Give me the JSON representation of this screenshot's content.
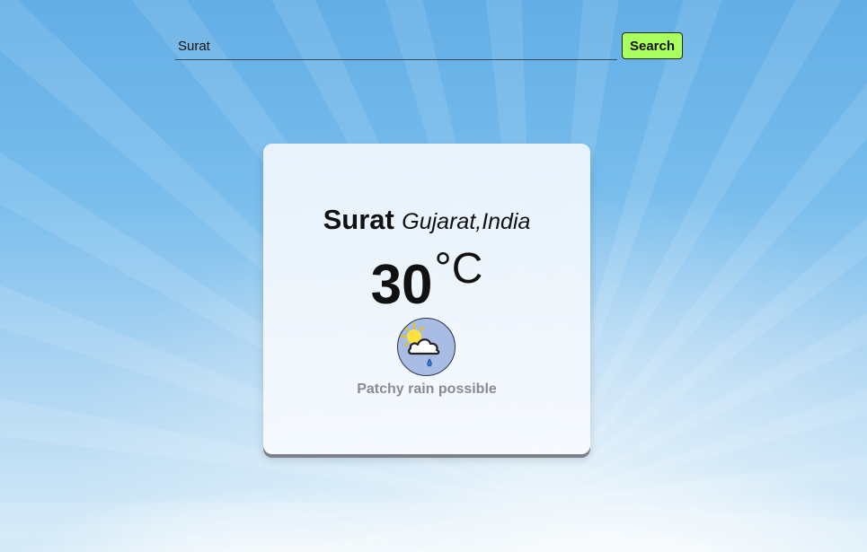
{
  "search": {
    "value": "Surat",
    "button_label": "Search"
  },
  "weather": {
    "city": "Surat",
    "region": "Gujarat,India",
    "temperature": "30",
    "unit": "°C",
    "condition": "Patchy rain possible",
    "icon": "patchy-rain-icon"
  },
  "colors": {
    "search_button": "#a8ff5e",
    "condition_text": "#888c91",
    "icon_background": "#a9bce3"
  }
}
